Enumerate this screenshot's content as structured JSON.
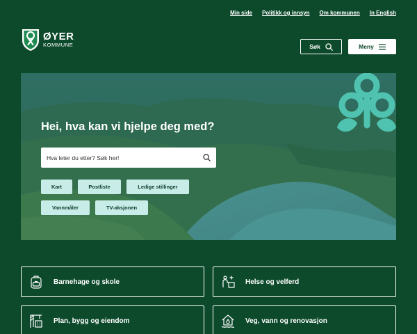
{
  "toplinks": [
    "Min side",
    "Politikk og innsyn",
    "Om kommunen",
    "In English"
  ],
  "logo": {
    "name": "ØYER",
    "sub": "KOMMUNE"
  },
  "header": {
    "search_label": "Søk",
    "menu_label": "Meny"
  },
  "hero": {
    "title": "Hei, hva kan vi hjelpe deg med?",
    "search_placeholder": "Hva leter du etter? Søk her!",
    "chips": [
      "Kart",
      "Postliste",
      "Ledige stillinger",
      "Vannmåler",
      "TV-aksjonen"
    ]
  },
  "cards": [
    "Barnehage og skole",
    "Helse og velferd",
    "Plan, bygg og eiendom",
    "Veg, vann og renovasjon"
  ],
  "colors": {
    "background": "#0d4a2c",
    "chip": "#c8ede8",
    "accent": "#4fc3b0"
  }
}
